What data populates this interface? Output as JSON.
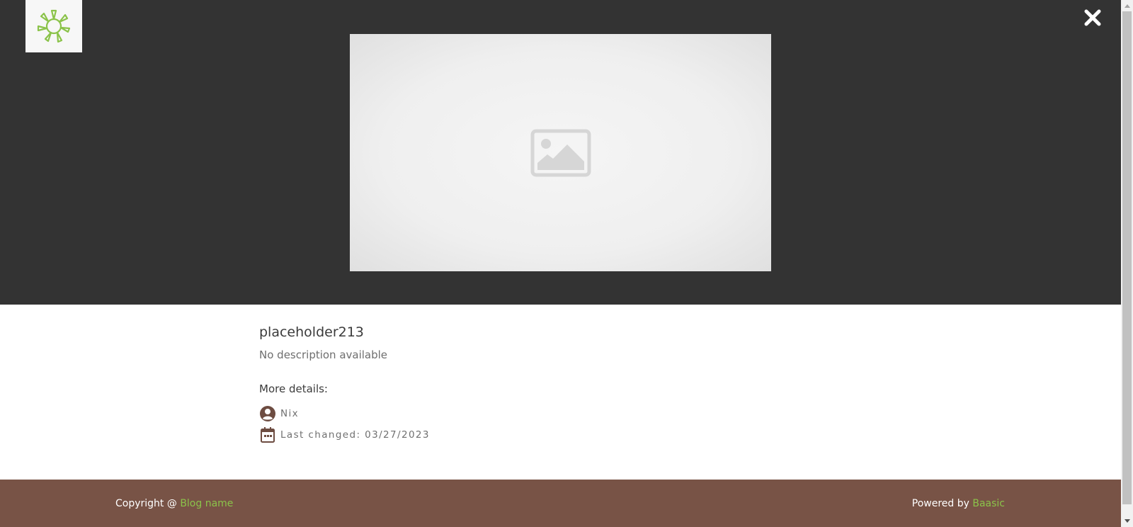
{
  "header": {
    "logo_icon": "sun-logo-icon",
    "close_icon": "close-icon",
    "image_placeholder_icon": "image-placeholder-icon"
  },
  "post": {
    "title": "placeholder213",
    "description": "No description available",
    "more_details_label": "More details:",
    "author": "Nix",
    "last_changed": "Last changed: 03/27/2023"
  },
  "footer": {
    "copyright_prefix": "Copyright @ ",
    "blog_link": "Blog name",
    "powered_prefix": "Powered by ",
    "powered_link": "Baasic"
  },
  "colors": {
    "hero_bg": "#333333",
    "footer_bg": "#785346",
    "accent": "#8bc34a",
    "icon_brown": "#6d4c41"
  }
}
